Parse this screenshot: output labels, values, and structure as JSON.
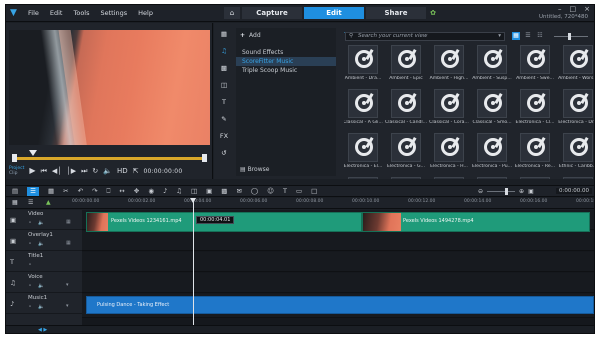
{
  "window": {
    "menu": [
      "File",
      "Edit",
      "Tools",
      "Settings",
      "Help"
    ],
    "mode_tabs": [
      "Capture",
      "Edit",
      "Share"
    ],
    "active_tab": "Edit",
    "doc_title": "Untitled, 720*480",
    "win_ctrls": [
      "–",
      "□",
      "×"
    ]
  },
  "player": {
    "project_label": "Project",
    "clip_label": "Clip",
    "hd_label": "HD",
    "timecode": "00:00:00:00"
  },
  "library": {
    "add_label": "Add",
    "items": [
      "Sound Effects",
      "ScoreFitter Music",
      "Triple Scoop Music"
    ],
    "selected_item": "ScoreFitter Music",
    "browse_label": "Browse",
    "search_placeholder": "Search your current view",
    "thumbnails": [
      "Ambient - Dra...",
      "Ambient - Epic",
      "Ambient - High...",
      "Ambient - Susp...",
      "Ambient - Swe...",
      "Ambient - Wors...",
      "Classical - A Gli...",
      "Classical - Candl...",
      "Classical - Cora...",
      "Classical - Smo...",
      "Electronica - Cl...",
      "Electronica - Dr...",
      "Electronica - El...",
      "Electronica - G...",
      "Electronica - H...",
      "Electronica - Pu...",
      "Electronica - Re...",
      "Ethnic - Caribb...",
      "",
      "",
      "",
      "",
      "",
      ""
    ],
    "accent": "#1f8fe0"
  },
  "timeline": {
    "timecode": "0:00:00.00",
    "ruler": [
      "00:00:00.00",
      "00:00:02.00",
      "00:00:04.00",
      "00:00:06.00",
      "00:00:08.00",
      "00:00:10.00",
      "00:00:12.00",
      "00:00:14.00",
      "00:00:16.00",
      "00:00:18.00"
    ],
    "tracks": [
      {
        "name": "Video"
      },
      {
        "name": "Overlay1"
      },
      {
        "name": "Title1"
      },
      {
        "name": "Voice"
      },
      {
        "name": "Music1"
      }
    ],
    "clips": {
      "video_a": "Pexels Videos 1234161.mp4",
      "video_b": "Pexels Videos 1494278.mp4",
      "music": "Pulsing Dance - Taking Effect"
    },
    "playhead_time": "00:00:04.01",
    "video_clip_color": "#1f9b7a",
    "music_clip_color": "#1f77c9"
  }
}
